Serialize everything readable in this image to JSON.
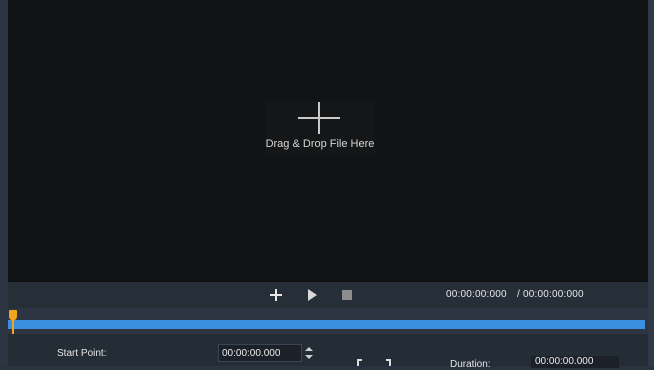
{
  "viewport": {
    "drop_text": "Drag & Drop File Here"
  },
  "controls": {
    "current_time": "00:00:00:000",
    "total_time": "/ 00:00:00:000"
  },
  "timeline": {
    "playhead_position": 0
  },
  "trim": {
    "start_label": "Start Point:",
    "start_value": "00:00:00.000",
    "duration_label": "Duration:",
    "duration_value": "00:00:00.000"
  },
  "colors": {
    "accent_track": "#3a8fe0",
    "playhead": "#f3a51c"
  },
  "icons": {
    "add": "plus-icon",
    "play": "play-icon",
    "stop": "stop-icon",
    "set_range": "bracket-icon"
  }
}
